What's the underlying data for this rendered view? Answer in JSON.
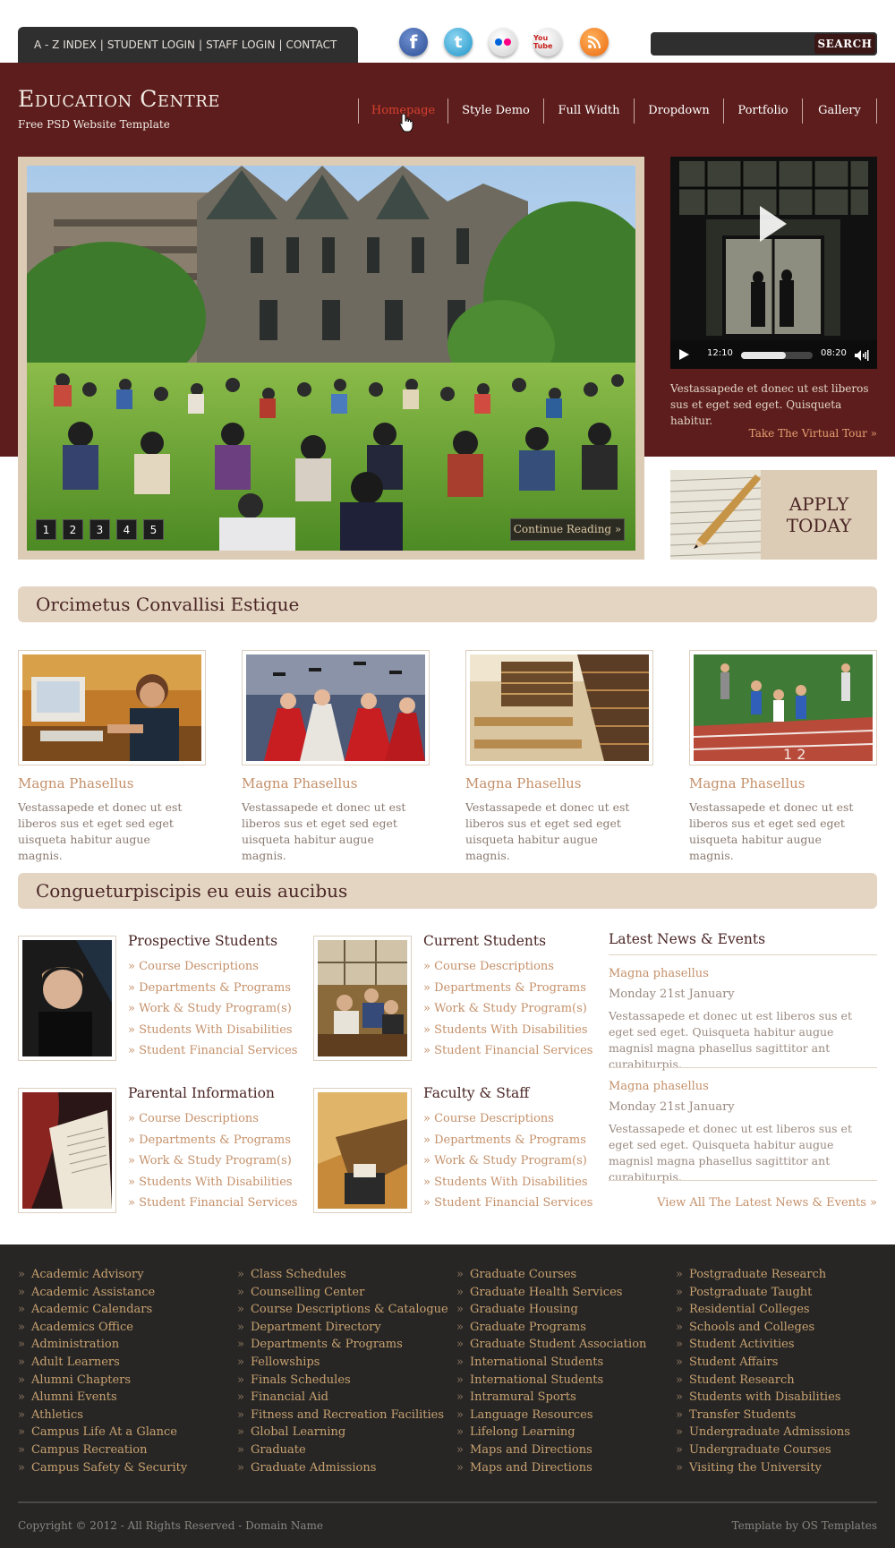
{
  "top_links": [
    "A - Z INDEX",
    "STUDENT LOGIN",
    "STAFF LOGIN",
    "CONTACT"
  ],
  "social": {
    "facebook": {
      "icon": "facebook-icon",
      "glyph": "f"
    },
    "twitter": {
      "icon": "twitter-icon",
      "glyph": "t"
    },
    "flickr": {
      "icon": "flickr-icon"
    },
    "youtube": {
      "icon": "youtube-icon",
      "glyph": "You Tube"
    },
    "rss": {
      "icon": "rss-icon"
    }
  },
  "search": {
    "placeholder": "",
    "button": "SEARCH"
  },
  "site": {
    "title": "Education Centre",
    "tagline": "Free PSD Website Template"
  },
  "nav": {
    "items": [
      "Homepage",
      "Style Demo",
      "Full Width",
      "Dropdown",
      "Portfolio",
      "Gallery"
    ],
    "active": "Homepage"
  },
  "hero": {
    "pager": [
      "1",
      "2",
      "3",
      "4",
      "5"
    ],
    "continue": "Continue Reading »"
  },
  "video": {
    "current_time": "12:10",
    "duration": "08:20",
    "progress": 0.62,
    "text": "Vestassapede et donec ut est liberos sus et eget sed eget. Quisqueta habitur.",
    "link": "Take The Virtual Tour »"
  },
  "apply": {
    "line1": "APPLY",
    "line2": "TODAY"
  },
  "section1": {
    "title": "Orcimetus Convallisi Estique",
    "cards": [
      {
        "title": "Magna Phasellus",
        "text": "Vestassapede et donec ut est liberos sus et eget sed eget uisqueta habitur augue magnis."
      },
      {
        "title": "Magna Phasellus",
        "text": "Vestassapede et donec ut est liberos sus et eget sed eget uisqueta habitur augue magnis."
      },
      {
        "title": "Magna Phasellus",
        "text": "Vestassapede et donec ut est liberos sus et eget sed eget uisqueta habitur augue magnis."
      },
      {
        "title": "Magna Phasellus",
        "text": "Vestassapede et donec ut est liberos sus et eget sed eget uisqueta habitur augue magnis."
      }
    ]
  },
  "section2": {
    "title": "Congueturpiscipis eu euis aucibus",
    "groups": [
      {
        "title": "Prospective Students",
        "links": [
          "» Course Descriptions",
          "» Departments & Programs",
          "» Work & Study Program(s)",
          "» Students With Disabilities",
          "» Student Financial Services"
        ]
      },
      {
        "title": "Current Students",
        "links": [
          "» Course Descriptions",
          "» Departments & Programs",
          "» Work & Study Program(s)",
          "» Students With Disabilities",
          "» Student Financial Services"
        ]
      },
      {
        "title": "Parental Information",
        "links": [
          "» Course Descriptions",
          "» Departments & Programs",
          "» Work & Study Program(s)",
          "» Students With Disabilities",
          "» Student Financial Services"
        ]
      },
      {
        "title": "Faculty & Staff",
        "links": [
          "» Course Descriptions",
          "» Departments & Programs",
          "» Work & Study Program(s)",
          "» Students With Disabilities",
          "» Student Financial Services"
        ]
      }
    ]
  },
  "news": {
    "title": "Latest News & Events",
    "items": [
      {
        "title": "Magna phasellus",
        "date": "Monday 21st January",
        "body": "Vestassapede et donec ut est liberos sus et eget sed eget. Quisqueta habitur augue magnisl magna phasellus sagittitor ant curabiturpis."
      },
      {
        "title": "Magna phasellus",
        "date": "Monday 21st January",
        "body": "Vestassapede et donec ut est liberos sus et eget sed eget. Quisqueta habitur augue magnisl magna phasellus sagittitor ant curabiturpis."
      }
    ],
    "view_all": "View All The Latest News & Events »"
  },
  "footer": {
    "columns": [
      [
        "Academic Advisory",
        "Academic Assistance",
        "Academic Calendars",
        "Academics Office",
        "Administration",
        "Adult Learners",
        "Alumni Chapters",
        "Alumni Events",
        "Athletics",
        "Campus Life At a Glance",
        "Campus Recreation",
        "Campus Safety & Security"
      ],
      [
        "Class Schedules",
        "Counselling Center",
        "Course Descriptions & Catalogue",
        "Department Directory",
        "Departments & Programs",
        "Fellowships",
        "Finals Schedules",
        "Financial Aid",
        "Fitness and Recreation Facilities",
        "Global Learning",
        "Graduate",
        "Graduate Admissions"
      ],
      [
        "Graduate Courses",
        "Graduate Health Services",
        "Graduate Housing",
        "Graduate Programs",
        "Graduate Student Association",
        "International Students",
        "International Students",
        "Intramural Sports",
        "Language Resources",
        "Lifelong Learning",
        "Maps and Directions",
        "Maps and Directions"
      ],
      [
        "Postgraduate Research",
        "Postgraduate Taught",
        "Residential Colleges",
        "Schools and Colleges",
        "Student Activities",
        "Student Affairs",
        "Student Research",
        "Students with Disabilities",
        "Transfer Students",
        "Undergraduate Admissions",
        "Undergraduate Courses",
        "Visiting the University"
      ]
    ],
    "copyright": "Copyright © 2012 - All Rights Reserved - Domain Name",
    "credit": "Template by OS Templates"
  },
  "colors": {
    "header": "#5c1d1c",
    "accent": "#c4906a",
    "footer": "#272625",
    "beige": "#e4d5c3"
  }
}
